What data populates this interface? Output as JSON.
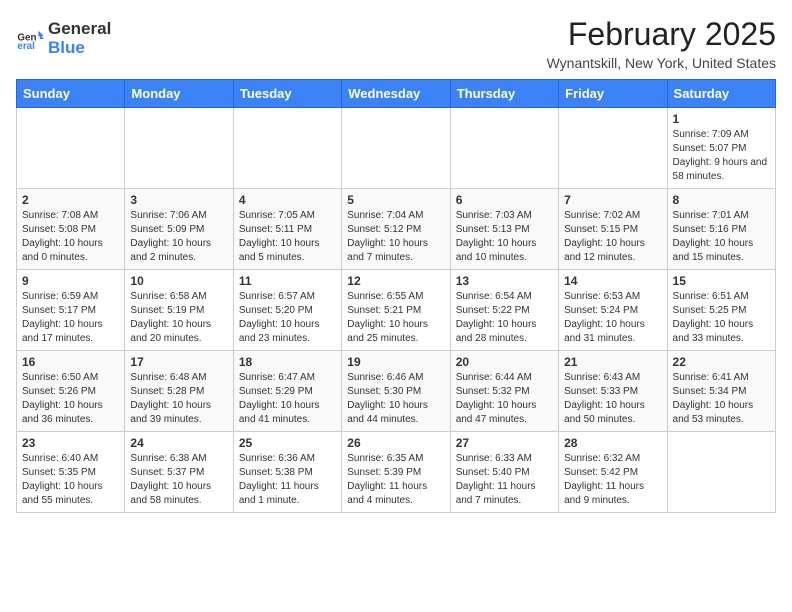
{
  "header": {
    "logo_line1": "General",
    "logo_line2": "Blue",
    "month_year": "February 2025",
    "location": "Wynantskill, New York, United States"
  },
  "weekdays": [
    "Sunday",
    "Monday",
    "Tuesday",
    "Wednesday",
    "Thursday",
    "Friday",
    "Saturday"
  ],
  "weeks": [
    [
      {
        "day": "",
        "info": ""
      },
      {
        "day": "",
        "info": ""
      },
      {
        "day": "",
        "info": ""
      },
      {
        "day": "",
        "info": ""
      },
      {
        "day": "",
        "info": ""
      },
      {
        "day": "",
        "info": ""
      },
      {
        "day": "1",
        "info": "Sunrise: 7:09 AM\nSunset: 5:07 PM\nDaylight: 9 hours and 58 minutes."
      }
    ],
    [
      {
        "day": "2",
        "info": "Sunrise: 7:08 AM\nSunset: 5:08 PM\nDaylight: 10 hours and 0 minutes."
      },
      {
        "day": "3",
        "info": "Sunrise: 7:06 AM\nSunset: 5:09 PM\nDaylight: 10 hours and 2 minutes."
      },
      {
        "day": "4",
        "info": "Sunrise: 7:05 AM\nSunset: 5:11 PM\nDaylight: 10 hours and 5 minutes."
      },
      {
        "day": "5",
        "info": "Sunrise: 7:04 AM\nSunset: 5:12 PM\nDaylight: 10 hours and 7 minutes."
      },
      {
        "day": "6",
        "info": "Sunrise: 7:03 AM\nSunset: 5:13 PM\nDaylight: 10 hours and 10 minutes."
      },
      {
        "day": "7",
        "info": "Sunrise: 7:02 AM\nSunset: 5:15 PM\nDaylight: 10 hours and 12 minutes."
      },
      {
        "day": "8",
        "info": "Sunrise: 7:01 AM\nSunset: 5:16 PM\nDaylight: 10 hours and 15 minutes."
      }
    ],
    [
      {
        "day": "9",
        "info": "Sunrise: 6:59 AM\nSunset: 5:17 PM\nDaylight: 10 hours and 17 minutes."
      },
      {
        "day": "10",
        "info": "Sunrise: 6:58 AM\nSunset: 5:19 PM\nDaylight: 10 hours and 20 minutes."
      },
      {
        "day": "11",
        "info": "Sunrise: 6:57 AM\nSunset: 5:20 PM\nDaylight: 10 hours and 23 minutes."
      },
      {
        "day": "12",
        "info": "Sunrise: 6:55 AM\nSunset: 5:21 PM\nDaylight: 10 hours and 25 minutes."
      },
      {
        "day": "13",
        "info": "Sunrise: 6:54 AM\nSunset: 5:22 PM\nDaylight: 10 hours and 28 minutes."
      },
      {
        "day": "14",
        "info": "Sunrise: 6:53 AM\nSunset: 5:24 PM\nDaylight: 10 hours and 31 minutes."
      },
      {
        "day": "15",
        "info": "Sunrise: 6:51 AM\nSunset: 5:25 PM\nDaylight: 10 hours and 33 minutes."
      }
    ],
    [
      {
        "day": "16",
        "info": "Sunrise: 6:50 AM\nSunset: 5:26 PM\nDaylight: 10 hours and 36 minutes."
      },
      {
        "day": "17",
        "info": "Sunrise: 6:48 AM\nSunset: 5:28 PM\nDaylight: 10 hours and 39 minutes."
      },
      {
        "day": "18",
        "info": "Sunrise: 6:47 AM\nSunset: 5:29 PM\nDaylight: 10 hours and 41 minutes."
      },
      {
        "day": "19",
        "info": "Sunrise: 6:46 AM\nSunset: 5:30 PM\nDaylight: 10 hours and 44 minutes."
      },
      {
        "day": "20",
        "info": "Sunrise: 6:44 AM\nSunset: 5:32 PM\nDaylight: 10 hours and 47 minutes."
      },
      {
        "day": "21",
        "info": "Sunrise: 6:43 AM\nSunset: 5:33 PM\nDaylight: 10 hours and 50 minutes."
      },
      {
        "day": "22",
        "info": "Sunrise: 6:41 AM\nSunset: 5:34 PM\nDaylight: 10 hours and 53 minutes."
      }
    ],
    [
      {
        "day": "23",
        "info": "Sunrise: 6:40 AM\nSunset: 5:35 PM\nDaylight: 10 hours and 55 minutes."
      },
      {
        "day": "24",
        "info": "Sunrise: 6:38 AM\nSunset: 5:37 PM\nDaylight: 10 hours and 58 minutes."
      },
      {
        "day": "25",
        "info": "Sunrise: 6:36 AM\nSunset: 5:38 PM\nDaylight: 11 hours and 1 minute."
      },
      {
        "day": "26",
        "info": "Sunrise: 6:35 AM\nSunset: 5:39 PM\nDaylight: 11 hours and 4 minutes."
      },
      {
        "day": "27",
        "info": "Sunrise: 6:33 AM\nSunset: 5:40 PM\nDaylight: 11 hours and 7 minutes."
      },
      {
        "day": "28",
        "info": "Sunrise: 6:32 AM\nSunset: 5:42 PM\nDaylight: 11 hours and 9 minutes."
      },
      {
        "day": "",
        "info": ""
      }
    ]
  ]
}
